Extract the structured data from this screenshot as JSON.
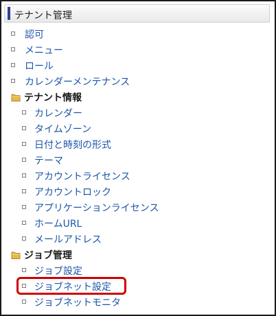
{
  "panel": {
    "title": "テナント管理",
    "accent_color": "#2d3f8f"
  },
  "menu": {
    "top_items": [
      {
        "label": "認可"
      },
      {
        "label": "メニュー"
      },
      {
        "label": "ロール"
      },
      {
        "label": "カレンダーメンテナンス"
      }
    ],
    "tenant_info": {
      "label": "テナント情報",
      "icon": "folder-icon",
      "items": [
        {
          "label": "カレンダー"
        },
        {
          "label": "タイムゾーン"
        },
        {
          "label": "日付と時刻の形式"
        },
        {
          "label": "テーマ"
        },
        {
          "label": "アカウントライセンス"
        },
        {
          "label": "アカウントロック"
        },
        {
          "label": "アプリケーションライセンス"
        },
        {
          "label": "ホームURL"
        },
        {
          "label": "メールアドレス"
        }
      ]
    },
    "job_management": {
      "label": "ジョブ管理",
      "icon": "folder-icon",
      "items": [
        {
          "label": "ジョブ設定"
        },
        {
          "label": "ジョブネット設定",
          "highlighted": true
        },
        {
          "label": "ジョブネットモニタ"
        }
      ]
    }
  },
  "colors": {
    "link": "#1b55a8",
    "highlight": "#d10000",
    "folder": "#e8b84a"
  }
}
